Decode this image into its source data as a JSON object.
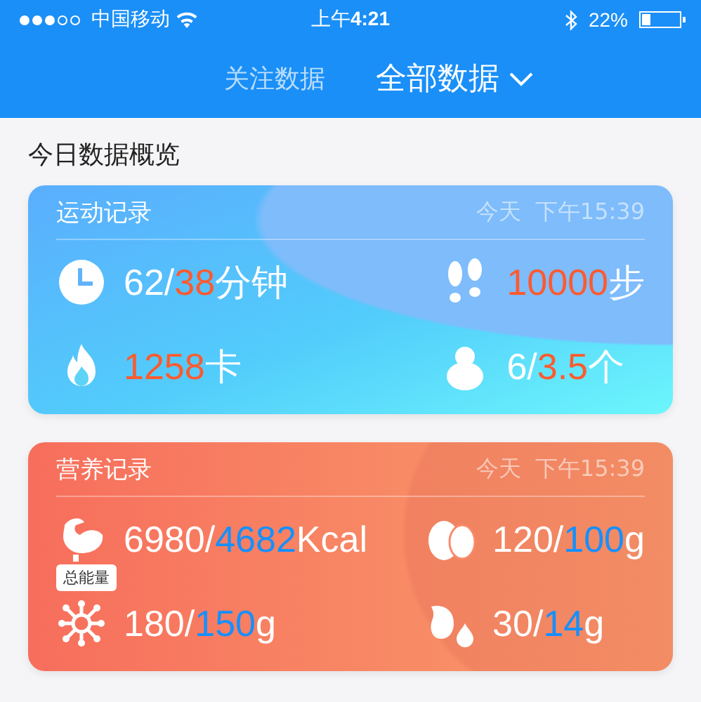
{
  "status_bar": {
    "signal_dots": [
      {
        "on": true
      },
      {
        "on": true
      },
      {
        "on": true
      },
      {
        "on": false
      },
      {
        "on": false
      }
    ],
    "carrier": "中国移动",
    "time": "上午**4:21**",
    "battery_percent": "22%",
    "battery": {
      "level": 0.22
    }
  },
  "nav": {
    "tabs": [
      {
        "label": "关注数据",
        "selected": false
      },
      {
        "label": "全部数据",
        "selected": true
      }
    ]
  },
  "section_title": "今日数据概览",
  "cards": [
    {
      "kind": "exercise",
      "title": "运动记录",
      "day": "今天",
      "time": "下午15:39",
      "stats": [
        {
          "kind": "time",
          "actual": "62/",
          "target": "38",
          "unit": "分钟"
        },
        {
          "kind": "steps",
          "target": "10000",
          "unit": "步"
        },
        {
          "kind": "burn",
          "target": "1258",
          "unit": "卡"
        },
        {
          "kind": "gourd",
          "actual": "6/",
          "target": "3.5",
          "unit": "个"
        }
      ]
    },
    {
      "kind": "nutrition",
      "title": "营养记录",
      "day": "今天",
      "time": "下午15:39",
      "stats": [
        {
          "kind": "energy",
          "actual": "6980/",
          "target": "4682",
          "unit": "Kcal",
          "tooltip": "总能量"
        },
        {
          "kind": "egg",
          "actual": "120/",
          "target": "100",
          "unit": "g"
        },
        {
          "kind": "molecule",
          "actual": "180/",
          "target": "150",
          "unit": "g"
        },
        {
          "kind": "drop",
          "actual": "30/",
          "target": "14",
          "unit": "g"
        }
      ]
    }
  ]
}
